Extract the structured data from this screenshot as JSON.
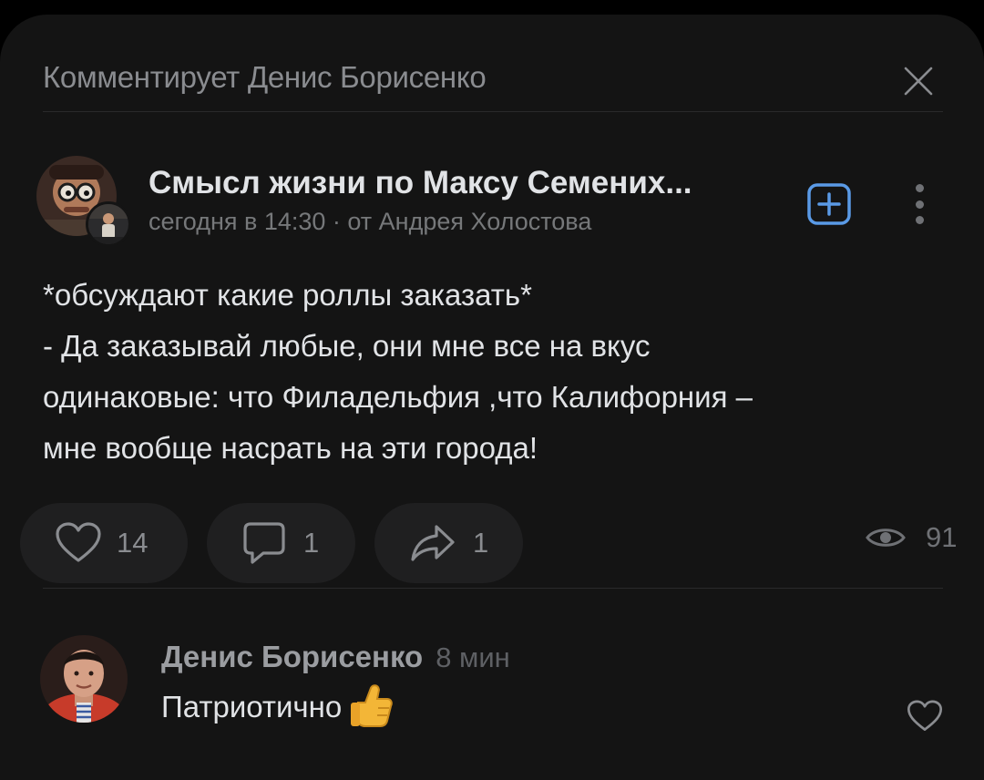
{
  "header": {
    "title": "Комментирует Денис Борисенко",
    "close_icon": "close-icon"
  },
  "post": {
    "community_name": "Смысл жизни по Максу Семених...",
    "meta": "сегодня в 14:30 · от Андрея Холостова",
    "body_lines": [
      "*обсуждают какие роллы заказать*",
      "- Да заказывай любые, они мне все на вкус",
      "одинаковые: что Филадельфия ,что Калифорния –",
      "мне вообще насрать на эти города!"
    ],
    "likes": "14",
    "comments": "1",
    "shares": "1",
    "views": "91",
    "accent_color": "#5a9ae6"
  },
  "comment": {
    "author": "Денис Борисенко",
    "time": "8 мин",
    "text": "Патриотично"
  }
}
